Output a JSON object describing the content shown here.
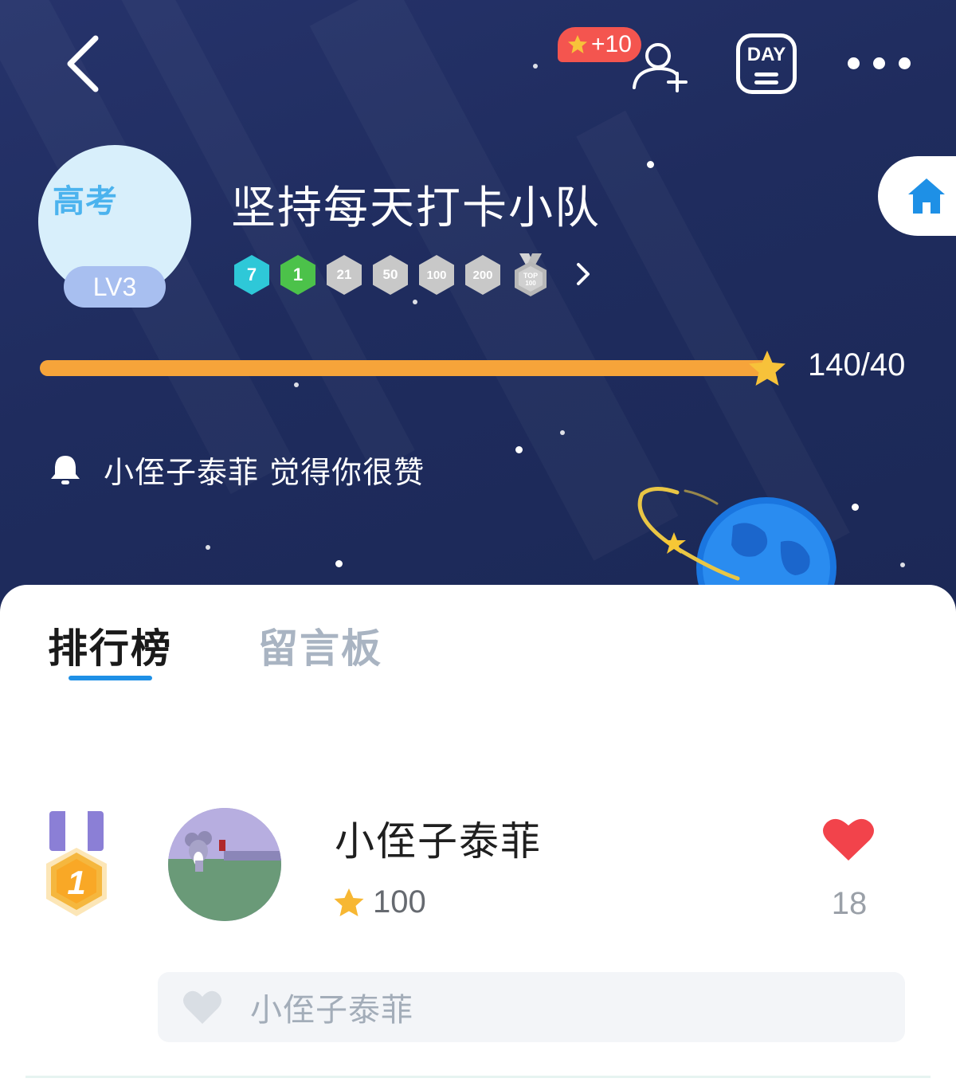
{
  "header": {
    "bonus_badge": "+10",
    "day_button_label": "DAY"
  },
  "team": {
    "avatar_text": "高考",
    "level": "LV3",
    "name": "坚持每天打卡小队",
    "badges": [
      {
        "label": "7",
        "color": "#2ec8d8"
      },
      {
        "label": "1",
        "color": "#4cc24a"
      },
      {
        "label": "21",
        "color": "#c8c8c8"
      },
      {
        "label": "50",
        "color": "#c8c8c8"
      },
      {
        "label": "100",
        "color": "#c8c8c8"
      },
      {
        "label": "200",
        "color": "#c8c8c8"
      },
      {
        "label": "TOP 100",
        "color": "#bdbdbd"
      }
    ]
  },
  "progress": {
    "text": "140/40",
    "fraction": 1.0,
    "color": "#f6a43a"
  },
  "notification": {
    "icon": "bell-icon",
    "text": "小侄子泰菲 觉得你很赞"
  },
  "tabs": [
    {
      "label": "排行榜",
      "active": true
    },
    {
      "label": "留言板",
      "active": false
    }
  ],
  "leaderboard": {
    "entries": [
      {
        "rank": "1",
        "name": "小侄子泰菲",
        "score": "100",
        "likes": "18",
        "liked_by": "小侄子泰菲"
      }
    ]
  },
  "colors": {
    "hero_bg": "#1f2c5e",
    "accent_blue": "#1e90e6",
    "heart_red": "#f2434b",
    "star_gold": "#f7b733"
  }
}
